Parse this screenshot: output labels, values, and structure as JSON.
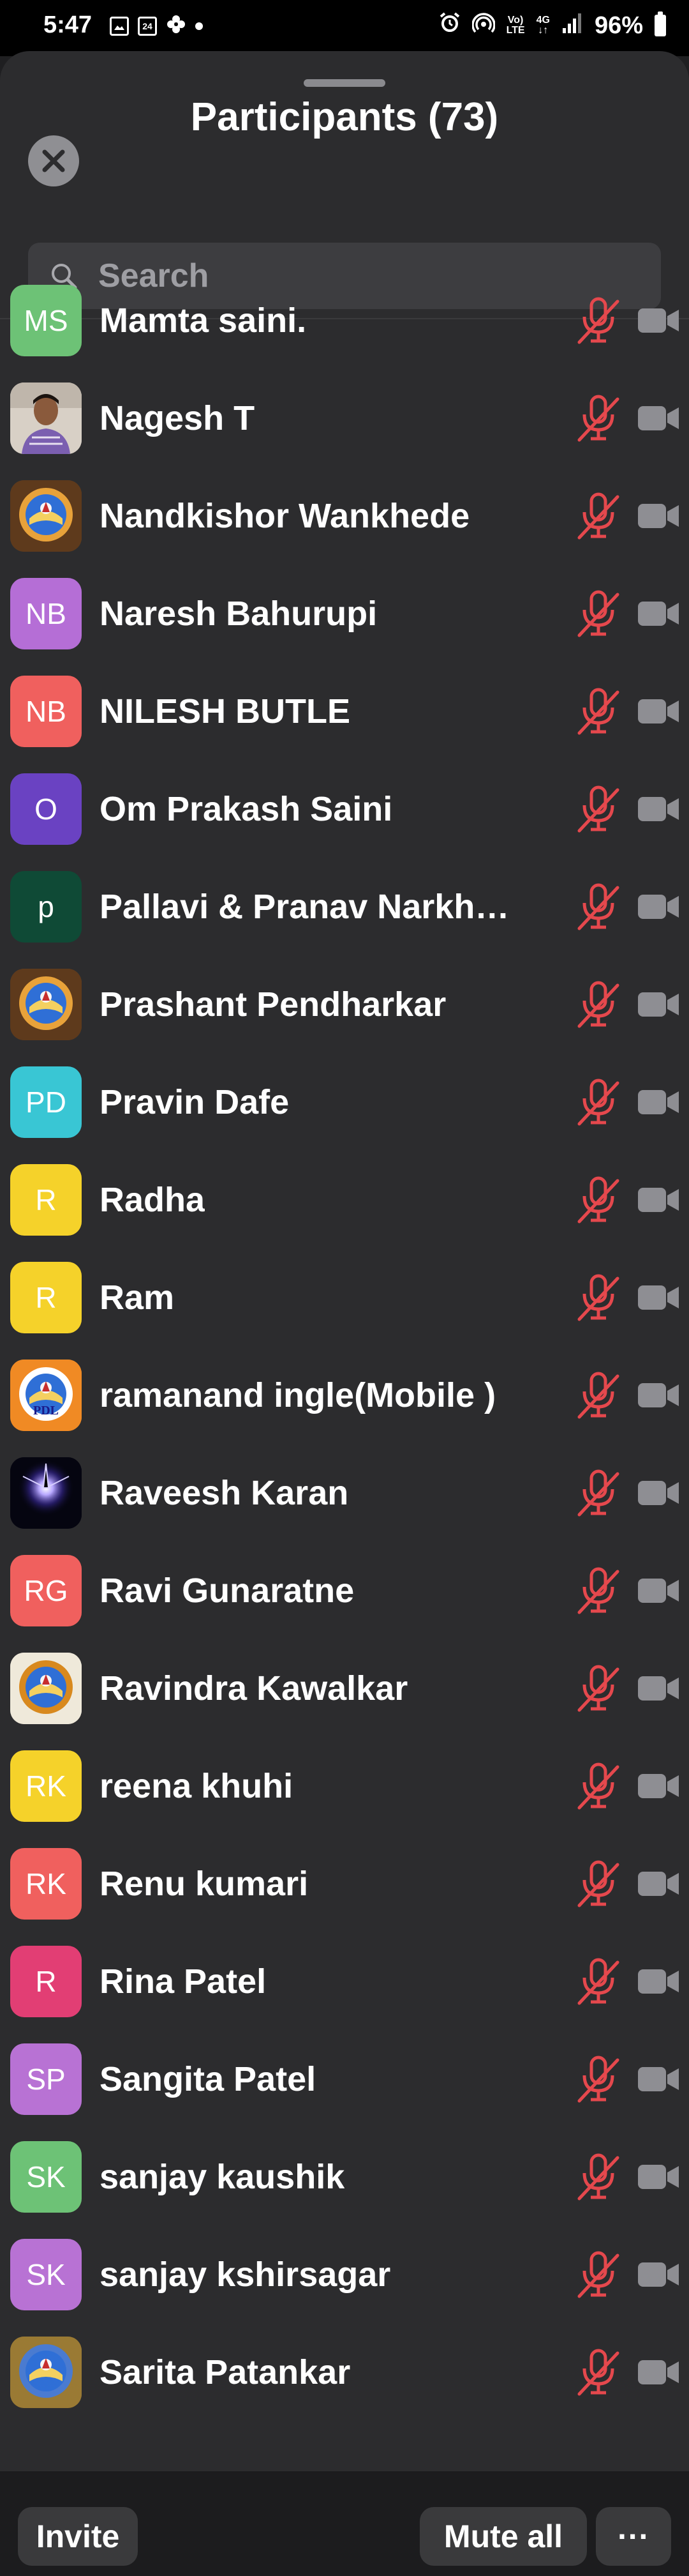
{
  "status_bar": {
    "time": "5:47",
    "calendar_day": "24",
    "network_top": "Vo)",
    "network_bottom": "LTE",
    "gen_top": "4G",
    "battery": "96%"
  },
  "header": {
    "title": "Participants (73)"
  },
  "search": {
    "placeholder": "Search"
  },
  "participants": [
    {
      "name": "Mamta saini.",
      "initials": "MS",
      "color": "#6dc276"
    },
    {
      "name": "Nagesh T",
      "initials": "",
      "color": "#c8bfb3",
      "photo": "person"
    },
    {
      "name": "Nandkishor Wankhede",
      "initials": "",
      "color": "#6b4422",
      "photo": "emblem"
    },
    {
      "name": "Naresh Bahurupi",
      "initials": "NB",
      "color": "#b56ed6"
    },
    {
      "name": "NILESH BUTLE",
      "initials": "NB",
      "color": "#f0605e"
    },
    {
      "name": "Om Prakash Saini",
      "initials": "O",
      "color": "#6a42c2"
    },
    {
      "name": "Pallavi & Pranav Narkhede",
      "initials": "p",
      "color": "#0f4a36"
    },
    {
      "name": "Prashant Pendharkar",
      "initials": "",
      "color": "#6b4422",
      "photo": "emblem"
    },
    {
      "name": "Pravin Dafe",
      "initials": "PD",
      "color": "#39c6d4"
    },
    {
      "name": "Radha",
      "initials": "R",
      "color": "#f5d22a"
    },
    {
      "name": "Ram",
      "initials": "R",
      "color": "#f5d22a"
    },
    {
      "name": "ramanand ingle(Mobile )",
      "initials": "",
      "color": "#e88a2a",
      "photo": "emblem-orange"
    },
    {
      "name": "Raveesh Karan",
      "initials": "",
      "color": "#08081a",
      "photo": "glow"
    },
    {
      "name": "Ravi Gunaratne",
      "initials": "RG",
      "color": "#f0605e"
    },
    {
      "name": "Ravindra Kawalkar",
      "initials": "",
      "color": "#e9e4d6",
      "photo": "emblem-light"
    },
    {
      "name": "reena khuhi",
      "initials": "RK",
      "color": "#f5d22a"
    },
    {
      "name": "Renu kumari",
      "initials": "RK",
      "color": "#f0605e"
    },
    {
      "name": "Rina Patel",
      "initials": "R",
      "color": "#e23e74"
    },
    {
      "name": "Sangita Patel",
      "initials": "SP",
      "color": "#b872d4"
    },
    {
      "name": "sanjay kaushik",
      "initials": "SK",
      "color": "#6dc276"
    },
    {
      "name": "sanjay kshirsagar",
      "initials": "SK",
      "color": "#b872d4"
    },
    {
      "name": "Sarita Patankar",
      "initials": "",
      "color": "#8a6a2a",
      "photo": "emblem-gold"
    }
  ],
  "avatar_text": {
    "pdl": "PDL"
  },
  "footer": {
    "invite_label": "Invite",
    "mute_all_label": "Mute all",
    "more_label": "···"
  },
  "colors": {
    "muted_mic": "#e5484d",
    "video_off": "#8e8e93",
    "sheet_bg": "#2c2c2e"
  },
  "icons": {
    "close": "close-icon",
    "search": "search-icon",
    "mic_muted": "mic-muted-icon",
    "camera": "video-camera-icon"
  }
}
